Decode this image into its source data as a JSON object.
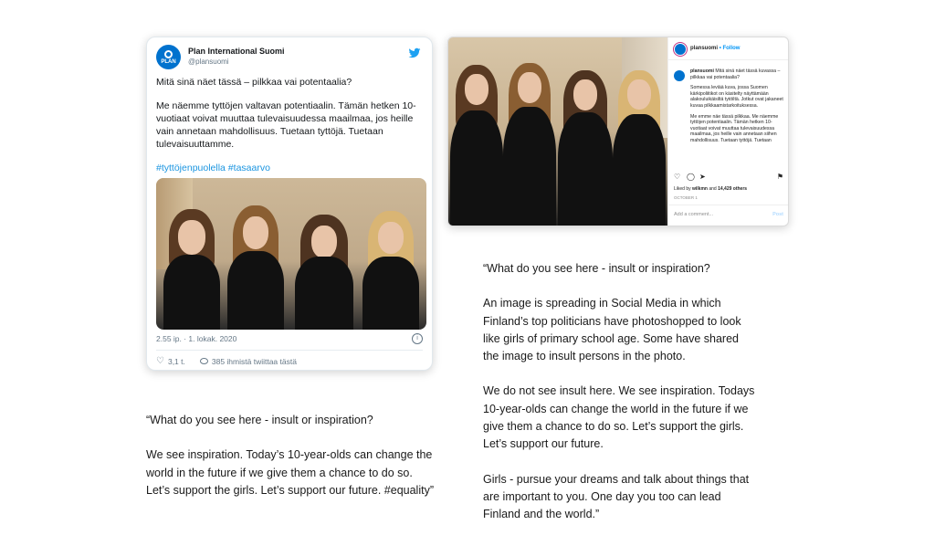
{
  "tweet": {
    "display_name": "Plan International Suomi",
    "handle": "@plansuomi",
    "avatar_text": "PLAN",
    "text_question": "Mitä sinä näet tässä – pilkkaa vai potentaalia?",
    "text_body": "Me näemme tyttöjen valtavan potentiaalin. Tämän hetken 10-vuotiaat voivat muuttaa tulevaisuudessa maailmaa, jos heille vain annetaan mahdollisuus. Tuetaan tyttöjä. Tuetaan tulevaisuuttamme.",
    "hashtags": "#tyttöjenpuolella #tasaarvo",
    "timestamp": "2.55 ip. · 1. lokak. 2020",
    "likes": "3,1 t.",
    "retweet_text": "385 ihmistä twiittaa tästä",
    "colors": {
      "link": "#1b95e0",
      "bird": "#1da1f2"
    }
  },
  "instagram": {
    "username": "plansuomi",
    "follow_text": "• Follow",
    "caption_user": "plansuomi",
    "caption_title": "Mitä sinä näet tässä kuvassa – pilkkaa vai potentaalia?",
    "caption_p1": "Somessa leviää kuva, jossa Suomen kärkipoliitikot on käsitelty näyttämään alakouluikäisiltä tytöiltä. Jotkut ovat jakaneet kuvaa pilkkaamistarkoituksessa.",
    "caption_p2": "Me emme näe tässä pilkkaa. Me näemme tyttöjen potentiaalin. Tämän hetken 10-vuotiaat voivat muuttaa tulevaisuudessa maailmaa, jos heille vain annetaan siihen mahdollisuus. Tuetaan tyttöjä. Tuetaan",
    "liked_by_prefix": "Liked by ",
    "liked_by_user": "wilkmn",
    "liked_by_mid": " and ",
    "liked_by_count": "14,429 others",
    "date": "OCTOBER 1",
    "comment_placeholder": "Add a comment...",
    "post_label": "Post"
  },
  "left_quote": {
    "p1": "“What do you see here - insult or inspiration?",
    "p2": "We see inspiration. Today’s 10-year-olds can change the world in the future if we give them a chance to do so. Let’s support the girls. Let’s support our future. #equality”"
  },
  "right_quote": {
    "p1": "“What do you see here - insult or inspiration?",
    "p2": "An image is spreading in Social Media in which Finland’s top politicians have photoshopped to look like girls of primary school age. Some have shared the image to insult persons in the photo.",
    "p3": "We do not see insult here. We see inspiration. Todays 10-year-olds can change the world in the future if we give them a chance to do so. Let’s support the girls. Let’s support our future.",
    "p4": "Girls - pursue your dreams and talk about things that are important to you. One day you too can lead Finland and the world.”"
  }
}
